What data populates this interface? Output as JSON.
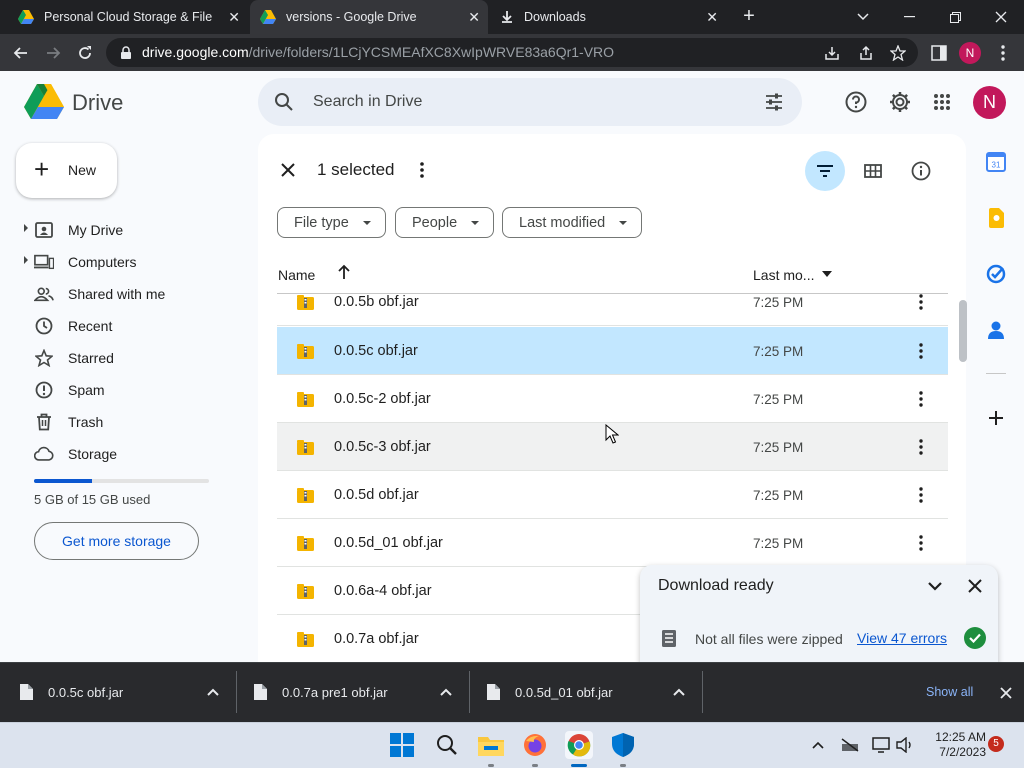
{
  "browser": {
    "tabs": [
      {
        "title": "Personal Cloud Storage & File Sh",
        "active": false
      },
      {
        "title": "versions - Google Drive",
        "active": true
      },
      {
        "title": "Downloads",
        "active": false
      }
    ],
    "url_host": "drive.google.com",
    "url_path": "/drive/folders/1LCjYCSMEAfXC8XwIpWRVE83a6Qr1-VRO",
    "profile_initial": "N"
  },
  "header": {
    "app_name": "Drive",
    "search_placeholder": "Search in Drive",
    "profile_initial": "N"
  },
  "sidebar": {
    "new_label": "New",
    "items": [
      {
        "label": "My Drive",
        "icon": "my-drive-icon",
        "expandable": true
      },
      {
        "label": "Computers",
        "icon": "computers-icon",
        "expandable": true
      },
      {
        "label": "Shared with me",
        "icon": "shared-icon",
        "expandable": false
      },
      {
        "label": "Recent",
        "icon": "clock-icon",
        "expandable": false
      },
      {
        "label": "Starred",
        "icon": "star-icon",
        "expandable": false
      },
      {
        "label": "Spam",
        "icon": "spam-icon",
        "expandable": false
      },
      {
        "label": "Trash",
        "icon": "trash-icon",
        "expandable": false
      },
      {
        "label": "Storage",
        "icon": "cloud-icon",
        "expandable": false
      }
    ],
    "storage_used_fraction": 0.33,
    "storage_text": "5 GB of 15 GB used",
    "get_more_label": "Get more storage"
  },
  "selection": {
    "count_label": "1 selected"
  },
  "filters": [
    {
      "label": "File type"
    },
    {
      "label": "People"
    },
    {
      "label": "Last modified"
    }
  ],
  "columns": {
    "name": "Name",
    "modified": "Last mo..."
  },
  "files": [
    {
      "name": "0.0.5b obf.jar",
      "time": "7:25 PM"
    },
    {
      "name": "0.0.5c obf.jar",
      "time": "7:25 PM"
    },
    {
      "name": "0.0.5c-2 obf.jar",
      "time": "7:25 PM"
    },
    {
      "name": "0.0.5c-3 obf.jar",
      "time": "7:25 PM"
    },
    {
      "name": "0.0.5d obf.jar",
      "time": "7:25 PM"
    },
    {
      "name": "0.0.5d_01 obf.jar",
      "time": "7:25 PM"
    },
    {
      "name": "0.0.6a-4 obf.jar",
      "time": ""
    },
    {
      "name": "0.0.7a obf.jar",
      "time": ""
    }
  ],
  "toast": {
    "title": "Download ready",
    "message": "Not all files were zipped",
    "link": "View 47 errors"
  },
  "downloads": {
    "items": [
      {
        "name": "0.0.5c obf.jar"
      },
      {
        "name": "0.0.7a pre1 obf.jar"
      },
      {
        "name": "0.0.5d_01 obf.jar"
      }
    ],
    "show_all": "Show all"
  },
  "taskbar": {
    "time": "12:25 AM",
    "date": "7/2/2023",
    "notifications": "5"
  },
  "colors": {
    "accent": "#0b57d0",
    "selected_row": "#c2e7ff",
    "avatar": "#c2185b"
  }
}
